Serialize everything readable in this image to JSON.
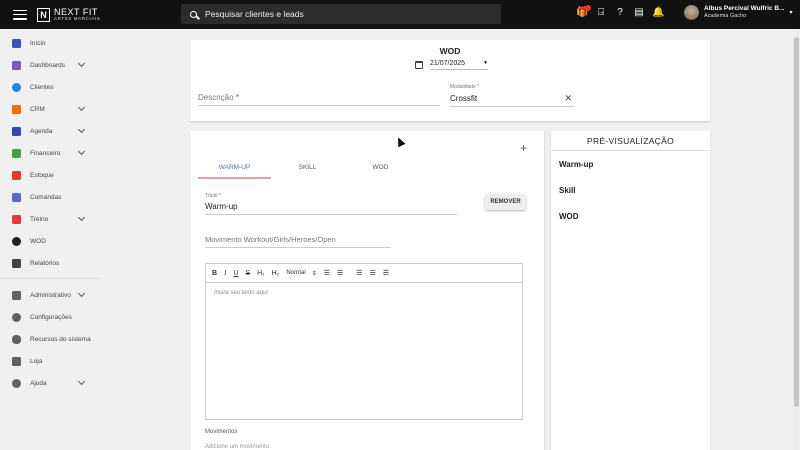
{
  "topbar": {
    "logo_main": "NEXT FIT",
    "logo_sub": "ARTES MARCIAIS",
    "search_placeholder": "Pesquisar clientes e leads",
    "user_name": "Albus Percival Wulfric B...",
    "user_sub": "Academia Gacho"
  },
  "sidebar": {
    "items": [
      {
        "label": "Início",
        "color": "#3f51b5"
      },
      {
        "label": "Dashboards",
        "color": "#7e57c2"
      },
      {
        "label": "Clientes",
        "color": "#1e88e5"
      },
      {
        "label": "CRM",
        "color": "#ef6c00"
      },
      {
        "label": "Agenda",
        "color": "#3949ab"
      },
      {
        "label": "Financeiro",
        "color": "#43a047"
      },
      {
        "label": "Estoque",
        "color": "#e53935"
      },
      {
        "label": "Comandas",
        "color": "#5c6bc0"
      },
      {
        "label": "Treino",
        "color": "#e53935"
      },
      {
        "label": "WOD",
        "color": "#212121"
      },
      {
        "label": "Relatórios",
        "color": "#424242"
      },
      {
        "label": "Administrativo",
        "color": "#616161"
      },
      {
        "label": "Configurações",
        "color": "#616161"
      },
      {
        "label": "Recursos do sistema",
        "color": "#616161"
      },
      {
        "label": "Loja",
        "color": "#616161"
      },
      {
        "label": "Ajuda",
        "color": "#616161"
      }
    ]
  },
  "header": {
    "title": "WOD",
    "date": "21/07/2025",
    "descricao_label": "Descrição",
    "descricao_req": "*",
    "modalidade_label": "Modalidade *",
    "modalidade_value": "Crossfit"
  },
  "editor": {
    "tabs": [
      "WARM-UP",
      "SKILL",
      "WOD"
    ],
    "titulo_label": "Título *",
    "titulo_value": "Warm-up",
    "remover_label": "REMOVER",
    "movimento_placeholder": "Movimento Workout/Girls/Heroes/Open",
    "rte_placeholder": "Insira seu texto aqui",
    "rte_format": "Normal",
    "movimentos_label": "Movimentos",
    "add_movimento": "Adicione um movimento"
  },
  "preview": {
    "title": "PRÉ-VISUALIZAÇÃO",
    "items": [
      "Warm-up",
      "Skill",
      "WOD"
    ]
  },
  "colors": {
    "topbar": "#111111",
    "accent_tab": "#4a6fb5",
    "tab_underline": "#e89aa6",
    "notification": "#e53935"
  }
}
